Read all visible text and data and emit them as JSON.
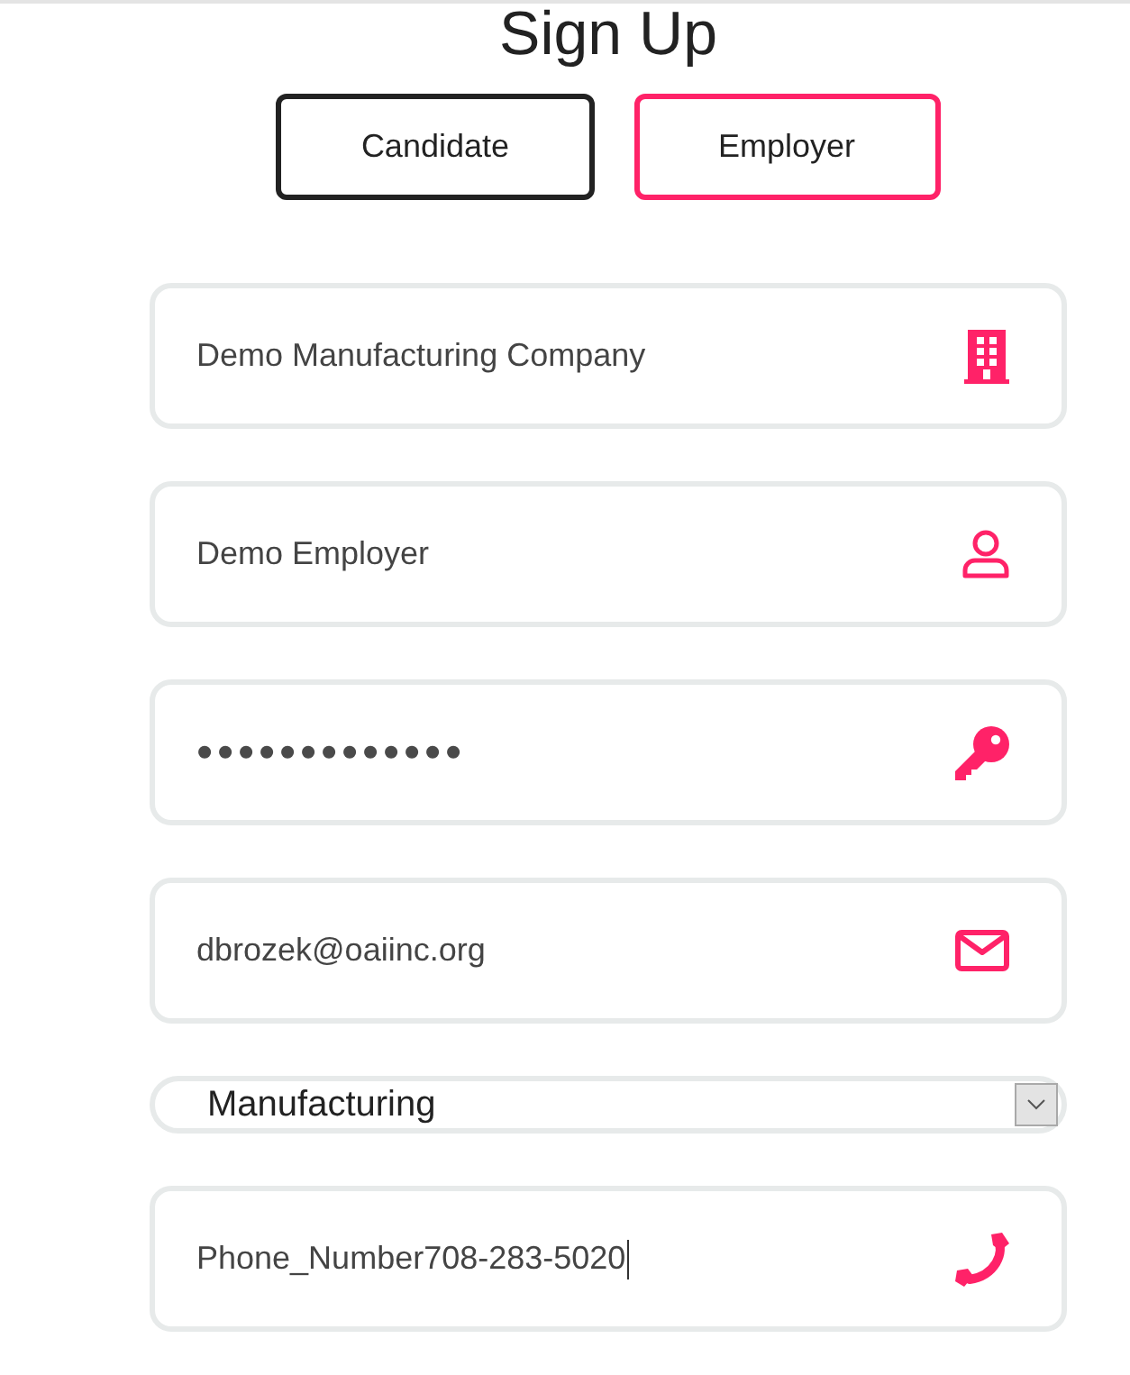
{
  "title": "Sign Up",
  "account_types": [
    {
      "label": "Candidate",
      "selected": false
    },
    {
      "label": "Employer",
      "selected": true
    }
  ],
  "fields": [
    {
      "kind": "company",
      "value": "Demo Manufacturing Company",
      "focused": false
    },
    {
      "kind": "name",
      "value": "Demo Employer",
      "focused": false
    },
    {
      "kind": "password",
      "value": "•••••••••••••",
      "focused": false
    },
    {
      "kind": "email",
      "value": "dbrozek@oaiinc.org",
      "focused": false
    },
    {
      "kind": "select",
      "value": "Manufacturing",
      "focused": false
    },
    {
      "kind": "phone",
      "value": "Phone_Number708-283-5020",
      "focused": true
    }
  ]
}
